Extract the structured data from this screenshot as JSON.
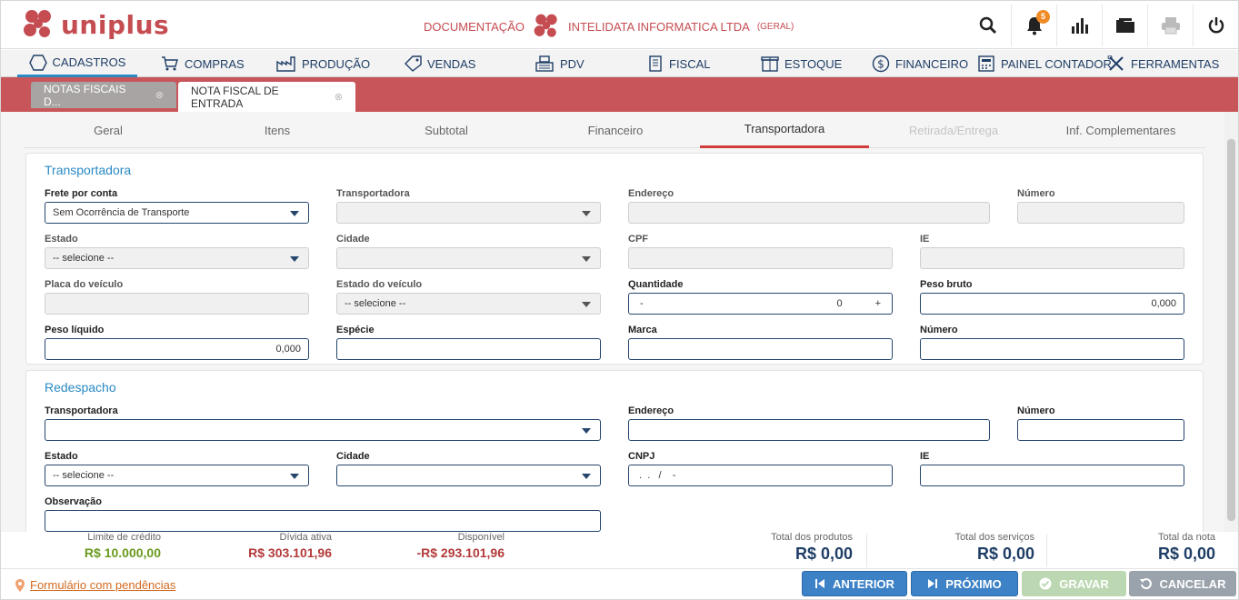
{
  "header": {
    "brand": "uniplus",
    "doc_link": "DOCUMENTAÇÃO",
    "company": "INTELIDATA INFORMATICA LTDA",
    "company_scope": "(GERAL)",
    "notifications_count": "5",
    "brand_color": "#c54d52"
  },
  "menu": [
    {
      "label": "CADASTROS",
      "icon": "cube-icon"
    },
    {
      "label": "COMPRAS",
      "icon": "cart-icon"
    },
    {
      "label": "PRODUÇÃO",
      "icon": "factory-icon"
    },
    {
      "label": "VENDAS",
      "icon": "tag-icon"
    },
    {
      "label": "PDV",
      "icon": "register-icon"
    },
    {
      "label": "FISCAL",
      "icon": "document-icon"
    },
    {
      "label": "ESTOQUE",
      "icon": "box-icon"
    },
    {
      "label": "FINANCEIRO",
      "icon": "dollar-icon"
    },
    {
      "label": "PAINEL CONTADOR",
      "icon": "calculator-icon"
    },
    {
      "label": "FERRAMENTAS",
      "icon": "tools-icon"
    }
  ],
  "doc_tabs": [
    {
      "label": "NOTAS FISCAIS D..."
    },
    {
      "label": "NOTA FISCAL DE ENTRADA"
    }
  ],
  "subtabs": [
    "Geral",
    "Itens",
    "Subtotal",
    "Financeiro",
    "Transportadora",
    "Retirada/Entrega",
    "Inf. Complementares"
  ],
  "transportadora": {
    "title": "Transportadora",
    "frete_label": "Frete por conta",
    "frete_value": "Sem Ocorrência de Transporte",
    "transportadora_label": "Transportadora",
    "endereco_label": "Endereço",
    "numero_label": "Número",
    "estado_label": "Estado",
    "estado_value": "-- selecione --",
    "cidade_label": "Cidade",
    "cpf_label": "CPF",
    "ie_label": "IE",
    "placa_label": "Placa do veículo",
    "estado_veiculo_label": "Estado do veículo",
    "estado_veiculo_value": "-- selecione --",
    "quantidade_label": "Quantidade",
    "quantidade_minus": "-",
    "quantidade_value": "0",
    "quantidade_plus": "+",
    "peso_bruto_label": "Peso bruto",
    "peso_bruto_value": "0,000",
    "peso_liquido_label": "Peso líquido",
    "peso_liquido_value": "0,000",
    "especie_label": "Espécie",
    "marca_label": "Marca",
    "numero2_label": "Número"
  },
  "redespacho": {
    "title": "Redespacho",
    "transportadora_label": "Transportadora",
    "endereco_label": "Endereço",
    "numero_label": "Número",
    "estado_label": "Estado",
    "estado_value": "-- selecione --",
    "cidade_label": "Cidade",
    "cnpj_label": "CNPJ",
    "cnpj_mask": " .  .   /    -",
    "ie_label": "IE",
    "observacao_label": "Observação"
  },
  "totals": {
    "limite_label": "Limite de crédito",
    "limite_value": "R$ 10.000,00",
    "divida_label": "Dívida ativa",
    "divida_value": "R$ 303.101,96",
    "disponivel_label": "Disponível",
    "disponivel_value": "-R$ 293.101,96",
    "produtos_label": "Total dos produtos",
    "produtos_value": "R$ 0,00",
    "servicos_label": "Total dos serviços",
    "servicos_value": "R$ 0,00",
    "nota_label": "Total da nota",
    "nota_value": "R$ 0,00"
  },
  "footer": {
    "pendencias": "Formulário com pendências",
    "anterior": "ANTERIOR",
    "proximo": "PRÓXIMO",
    "gravar": "GRAVAR",
    "cancelar": "CANCELAR"
  }
}
